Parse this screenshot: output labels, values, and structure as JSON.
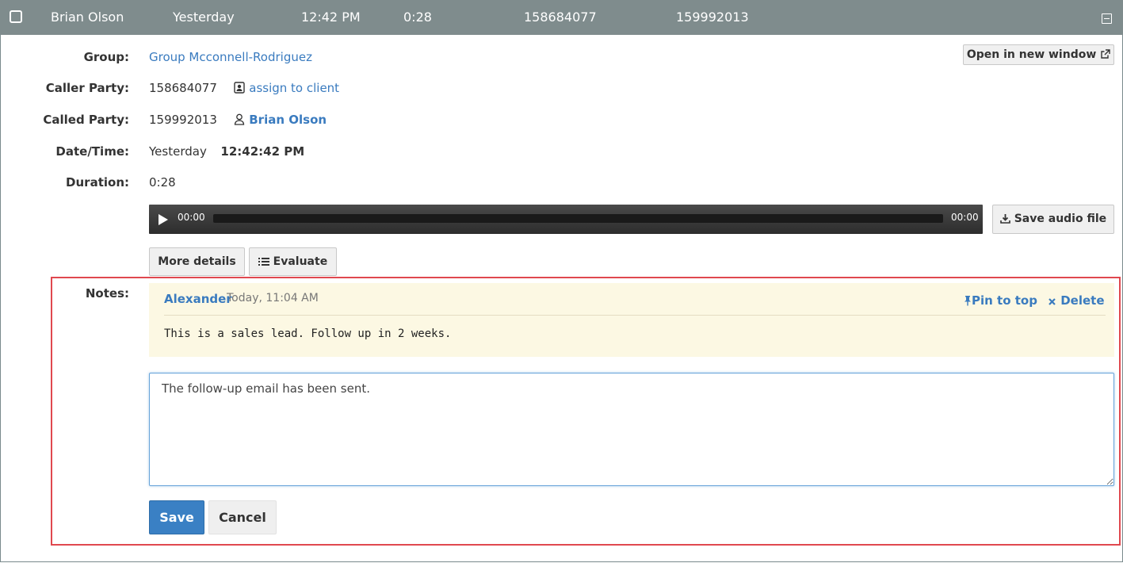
{
  "row": {
    "name": "Brian Olson",
    "date": "Yesterday",
    "time": "12:42 PM",
    "duration": "0:28",
    "caller": "158684077",
    "called": "159992013"
  },
  "details": {
    "group_label": "Group:",
    "group_value": "Group Mcconnell-Rodriguez",
    "caller_label": "Caller Party:",
    "caller_value": "158684077",
    "assign_link": "assign to client",
    "called_label": "Called Party:",
    "called_value": "159992013",
    "called_name": "Brian Olson",
    "datetime_label": "Date/Time:",
    "datetime_day": "Yesterday",
    "datetime_time": "12:42:42 PM",
    "duration_label": "Duration:",
    "duration_value": "0:28"
  },
  "toolbar": {
    "open_new_window": "Open in new window",
    "save_audio": "Save audio file",
    "more_details": "More details",
    "evaluate": "Evaluate"
  },
  "player": {
    "current_time": "00:00",
    "total_time": "00:00",
    "progress": 0
  },
  "notes": {
    "label": "Notes:",
    "entry": {
      "author": "Alexander",
      "timestamp": "Today, 11:04 AM",
      "text": "This is a sales lead. Follow up in 2 weeks.",
      "pin_label": "Pin to top",
      "delete_label": "Delete"
    },
    "input_value": "The follow-up email has been sent.",
    "save_label": "Save",
    "cancel_label": "Cancel"
  },
  "colors": {
    "header_bg": "#7f8c8d",
    "link": "#3a7bbf",
    "note_bg": "#fcf8e3",
    "highlight_border": "#e0484f",
    "primary_button": "#3a80c4"
  },
  "icons": {
    "row_checkbox": "checkbox-icon",
    "collapse": "collapse-icon",
    "external": "external-link-icon",
    "contact": "contact-card-icon",
    "user": "user-icon",
    "download": "download-icon",
    "list": "list-icon",
    "play": "play-icon",
    "pin": "pin-icon",
    "delete": "times-icon"
  }
}
